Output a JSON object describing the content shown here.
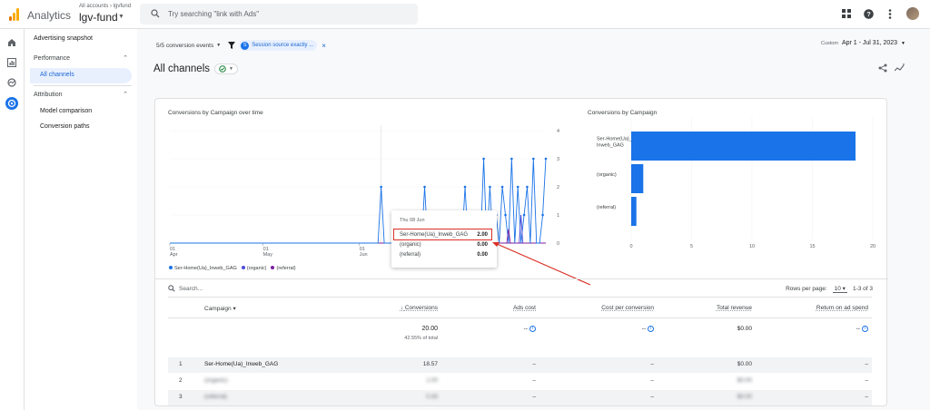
{
  "topbar": {
    "app_title": "Analytics",
    "account_crumb": "All accounts › lgvfund",
    "account_name": "lgv-fund",
    "search_placeholder": "Try searching \"link with Ads\"",
    "icons": [
      "apps-icon",
      "help-icon",
      "more-vert-icon",
      "avatar"
    ]
  },
  "sidenav": {
    "top_item": "Advertising snapshot",
    "sections": [
      {
        "label": "Performance",
        "items": [
          {
            "label": "All channels",
            "active": true
          }
        ]
      },
      {
        "label": "Attribution",
        "items": [
          {
            "label": "Model comparison"
          },
          {
            "label": "Conversion paths"
          }
        ]
      }
    ]
  },
  "filterbar": {
    "conversion_events": "5/5 conversion events",
    "filter_badge": "S",
    "filter_text": "Session source exactly ..."
  },
  "daterange": {
    "label": "Custom",
    "value": "Apr 1 - Jul 31, 2023"
  },
  "page_title": "All channels",
  "line_chart": {
    "title": "Conversions by Campaign over time",
    "x_ticks": [
      {
        "day": "01",
        "month": "Apr"
      },
      {
        "day": "01",
        "month": "May"
      },
      {
        "day": "01",
        "month": "Jun"
      },
      {
        "day": "01",
        "month": "Jul"
      }
    ],
    "y_ticks": [
      "4",
      "3",
      "2",
      "1",
      "0"
    ],
    "legend": [
      {
        "name": "Ser-Home(Ua)_Inweb_GAG",
        "color": "#1a73e8"
      },
      {
        "name": "(organic)",
        "color": "#4e4bd9"
      },
      {
        "name": "(referral)",
        "color": "#7b1fa2"
      }
    ],
    "tooltip": {
      "date": "Thu 08 Jun",
      "rows": [
        {
          "label": "Ser-Home(Ua)_Inweb_GAG",
          "value": "2.00"
        },
        {
          "label": "(organic)",
          "value": "0.00"
        },
        {
          "label": "(referral)",
          "value": "0.00"
        }
      ]
    }
  },
  "chart_data": [
    {
      "type": "line",
      "title": "Conversions by Campaign over time",
      "x_range": [
        "2023-04-01",
        "2023-07-31"
      ],
      "ylim": [
        0,
        4
      ],
      "series": [
        {
          "name": "Ser-Home(Ua)_Inweb_GAG",
          "x": [
            "2023-06-08",
            "2023-06-22",
            "2023-07-03",
            "2023-07-05",
            "2023-07-08",
            "2023-07-11",
            "2023-07-13",
            "2023-07-15",
            "2023-07-17",
            "2023-07-18",
            "2023-07-20",
            "2023-07-22",
            "2023-07-24",
            "2023-07-25",
            "2023-07-27",
            "2023-07-30",
            "2023-07-31"
          ],
          "values": [
            2,
            2,
            1,
            2,
            1,
            3,
            2,
            1,
            2,
            1,
            3,
            2,
            1,
            2,
            3,
            1,
            3
          ]
        },
        {
          "name": "(organic)",
          "x": [
            "2023-07-23"
          ],
          "values": [
            1
          ]
        },
        {
          "name": "(referral)",
          "x": [
            "2023-07-19"
          ],
          "values": [
            0.5
          ]
        }
      ]
    },
    {
      "type": "bar",
      "title": "Conversions by Campaign",
      "categories": [
        "Ser-Home(Ua)_Inweb_GAG",
        "(organic)",
        "(referral)"
      ],
      "values": [
        18.57,
        1,
        0.43
      ],
      "x_ticks": [
        "0",
        "5",
        "10",
        "15",
        "20"
      ],
      "xlim": [
        0,
        20
      ]
    }
  ],
  "table": {
    "search_placeholder": "Search...",
    "rows_per_page_label": "Rows per page:",
    "rows_per_page": "10",
    "range": "1-3 of 3",
    "headers": [
      "Campaign",
      "Conversions",
      "Ads cost",
      "Cost per conversion",
      "Total revenue",
      "Return on ad spend"
    ],
    "totals": {
      "conversions": "20.00",
      "conversions_sub": "42.55% of total",
      "ads_cost": "--",
      "cost_per_conversion": "--",
      "total_revenue": "$0.00",
      "roas": "--"
    },
    "rows": [
      {
        "idx": "1",
        "campaign": "Ser-Home(Ua)_Inweb_GAG",
        "conversions": "18.57",
        "ads_cost": "–",
        "cpc": "–",
        "revenue": "$0.00",
        "roas": "–"
      },
      {
        "idx": "2",
        "campaign": "(organic)",
        "conversions": "1.00",
        "ads_cost": "–",
        "cpc": "–",
        "revenue": "$0.00",
        "roas": "–"
      },
      {
        "idx": "3",
        "campaign": "(referral)",
        "conversions": "0.43",
        "ads_cost": "–",
        "cpc": "–",
        "revenue": "$0.00",
        "roas": "–"
      }
    ]
  }
}
